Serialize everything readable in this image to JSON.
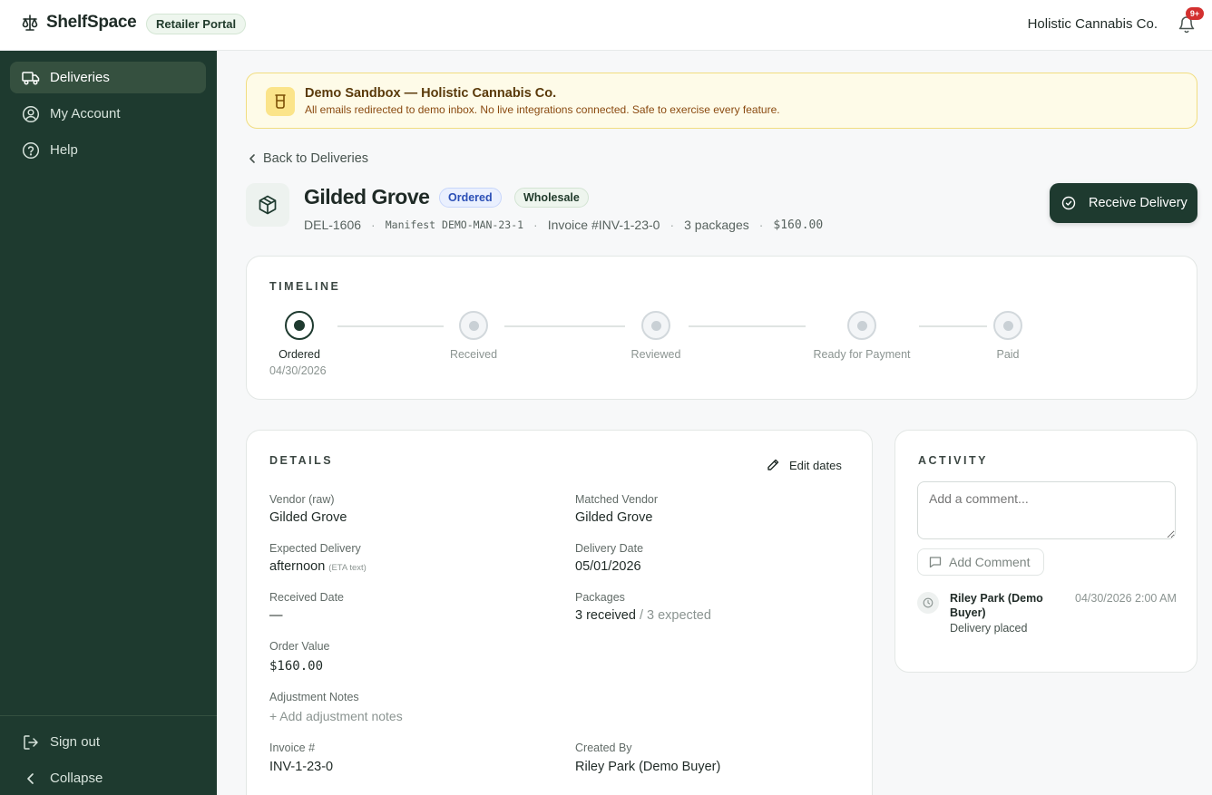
{
  "app": {
    "brand": "ShelfSpace",
    "portal_badge": "Retailer Portal",
    "org_name": "Holistic Cannabis Co.",
    "notifications_badge": "9+"
  },
  "sidebar": {
    "items": [
      {
        "label": "Deliveries",
        "icon": "truck-icon",
        "active": true
      },
      {
        "label": "My Account",
        "icon": "user-circle-icon",
        "active": false
      },
      {
        "label": "Help",
        "icon": "help-circle-icon",
        "active": false
      }
    ],
    "footer": [
      {
        "label": "Sign out",
        "icon": "sign-out-icon"
      },
      {
        "label": "Collapse",
        "icon": "chevron-left-icon"
      }
    ]
  },
  "banner": {
    "title": "Demo Sandbox — Holistic Cannabis Co.",
    "text": "All emails redirected to demo inbox. No live integrations connected. Safe to exercise every feature."
  },
  "back_link": "Back to Deliveries",
  "delivery": {
    "title": "Gilded Grove",
    "status": "Ordered",
    "type": "Wholesale",
    "id": "DEL-1606",
    "manifest": "Manifest DEMO-MAN-23-1",
    "invoice": "Invoice #INV-1-23-0",
    "packages": "3 packages",
    "price": "$160.00",
    "receive_button": "Receive Delivery"
  },
  "timeline": {
    "title": "TIMELINE",
    "steps": [
      {
        "label": "Ordered",
        "date": "04/30/2026",
        "done": true
      },
      {
        "label": "Received",
        "done": false
      },
      {
        "label": "Reviewed",
        "done": false
      },
      {
        "label": "Ready for Payment",
        "done": false
      },
      {
        "label": "Paid",
        "done": false
      }
    ]
  },
  "details": {
    "title": "DETAILS",
    "edit_dates": "Edit dates",
    "vendor_raw_label": "Vendor (raw)",
    "vendor_raw": "Gilded Grove",
    "matched_vendor_label": "Matched Vendor",
    "matched_vendor": "Gilded Grove",
    "expected_delivery_label": "Expected Delivery",
    "expected_delivery": "afternoon",
    "eta_note": "(ETA text)",
    "delivery_date_label": "Delivery Date",
    "delivery_date": "05/01/2026",
    "received_date_label": "Received Date",
    "received_date": "—",
    "packages_label": "Packages",
    "packages_received": "3 received",
    "packages_expected": "/ 3 expected",
    "order_value_label": "Order Value",
    "order_value": "$160.00",
    "adjustment_notes_label": "Adjustment Notes",
    "add_adjustment_notes": "+ Add adjustment notes",
    "invoice_label": "Invoice #",
    "invoice": "INV-1-23-0",
    "created_by_label": "Created By",
    "created_by": "Riley Park (Demo Buyer)"
  },
  "activity": {
    "title": "ACTIVITY",
    "comment_placeholder": "Add a comment...",
    "add_comment": "Add Comment",
    "entries": [
      {
        "who": "Riley Park (Demo Buyer)",
        "what": "Delivery placed",
        "when": "04/30/2026 2:00 AM"
      }
    ]
  },
  "colors": {
    "sidebar_bg": "#1e3a2f",
    "accent": "#1e3a2f",
    "banner_bg": "#fefbe8",
    "ordered_pill": "#2b4fb6",
    "notification_badge": "#d3302f"
  }
}
